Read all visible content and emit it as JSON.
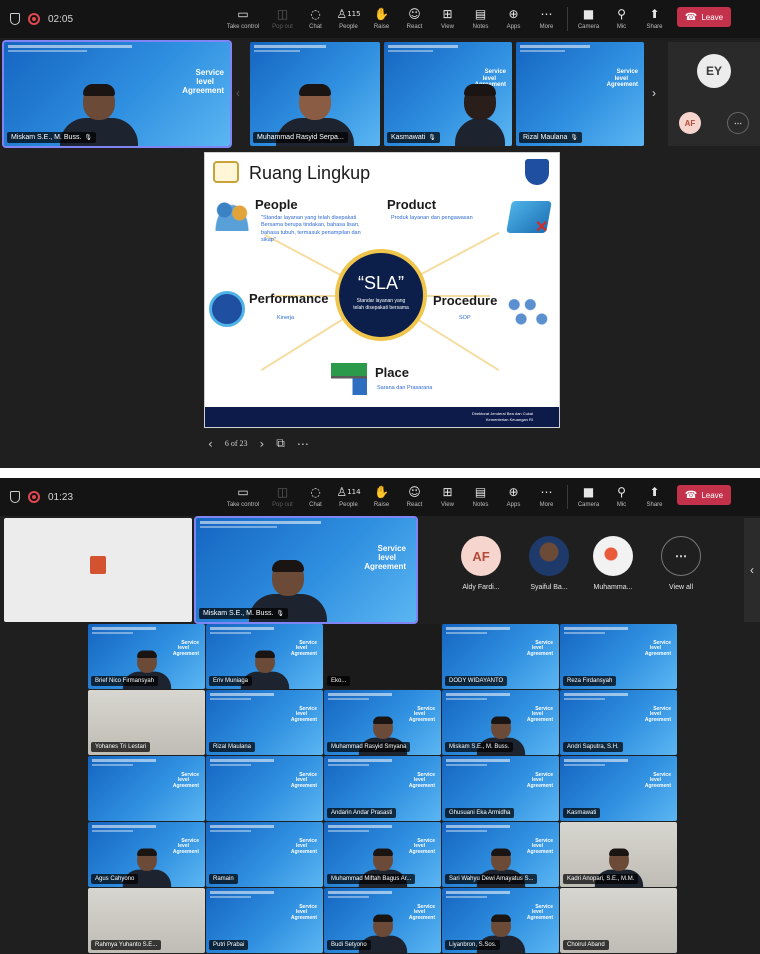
{
  "toolbar_top": {
    "timer": "02:05",
    "people_count": "115",
    "buttons": [
      {
        "label": "Take control",
        "icon": "take-control-icon"
      },
      {
        "label": "Pop out",
        "icon": "pop-out-icon"
      },
      {
        "label": "Chat",
        "icon": "chat-icon"
      },
      {
        "label": "People",
        "icon": "people-icon"
      },
      {
        "label": "Raise",
        "icon": "raise-hand-icon"
      },
      {
        "label": "React",
        "icon": "react-icon"
      },
      {
        "label": "View",
        "icon": "view-icon"
      },
      {
        "label": "Notes",
        "icon": "notes-icon"
      },
      {
        "label": "Apps",
        "icon": "apps-icon"
      },
      {
        "label": "More",
        "icon": "more-icon"
      },
      {
        "label": "Camera",
        "icon": "camera-off-icon"
      },
      {
        "label": "Mic",
        "icon": "mic-off-icon"
      },
      {
        "label": "Share",
        "icon": "share-icon"
      }
    ],
    "leave": "Leave"
  },
  "toolbar_bottom": {
    "timer": "01:23",
    "people_count": "114",
    "leave": "Leave"
  },
  "top_tiles": [
    {
      "name": "Miskam S.E., M. Buss.",
      "sla": [
        "Service",
        "level",
        "Agreement"
      ]
    },
    {
      "name": "Muhammad Rasyid Serpa..."
    },
    {
      "name": "Kasmawati"
    },
    {
      "name": "Rizal Maulana"
    }
  ],
  "top_avatars": {
    "ey": "EY",
    "af": "AF"
  },
  "slide": {
    "title": "Ruang Lingkup",
    "people": {
      "head": "People",
      "sub": "\"Standar layanan yang telah disepakati Bersama berupa tindakan, bahasa lisan, bahasa tubuh, termasuk penampilan dan sikap\""
    },
    "product": {
      "head": "Product",
      "sub": "Produk layanan dan pengawasan"
    },
    "performance": {
      "head": "Performance",
      "sub": "Kinerja"
    },
    "procedure": {
      "head": "Procedure",
      "sub": "SOP"
    },
    "place": {
      "head": "Place",
      "sub": "Sarana dan Prasarana"
    },
    "center": {
      "big": "“SLA”",
      "small": "Standar layanan yang telah disepakati bersama"
    },
    "footer": "Direktorat Jenderal Bea dan Cukai Kementerian Keuangan RI",
    "page": "6 of 23"
  },
  "bottom_featured": {
    "name": "Miskam S.E., M. Buss.",
    "sla": [
      "Service",
      "level",
      "Agreement"
    ]
  },
  "bottom_avatars": [
    {
      "initials": "AF",
      "label": "Aldy Fardi..."
    },
    {
      "initials": "",
      "label": "Syaiful Ba..."
    },
    {
      "initials": "",
      "label": "Muhamma..."
    },
    {
      "initials": "⋯",
      "label": "View all"
    }
  ],
  "grid": [
    {
      "name": "Brief Nico Firmansyah"
    },
    {
      "name": "Eriv Muniaga"
    },
    {
      "name": "Eko..."
    },
    {
      "name": "DODY WIDAYANTO"
    },
    {
      "name": "Reza Firdansyah"
    },
    {
      "name": "Yohanes Tri Lestari"
    },
    {
      "name": "Rizal Maulana"
    },
    {
      "name": "Muhammad Rasyid Smyana"
    },
    {
      "name": "Miskam S.E., M. Buss."
    },
    {
      "name": "Andri Saputra, S.H."
    },
    {
      "name": ""
    },
    {
      "name": ""
    },
    {
      "name": "Andarin Andar Prasasti"
    },
    {
      "name": "Ghusuani Eka Armidha"
    },
    {
      "name": "Kasmawati"
    },
    {
      "name": "Agus Cahyono"
    },
    {
      "name": "Ramain"
    },
    {
      "name": "Muhammad Miftah Bagus Ar..."
    },
    {
      "name": "Sari Wahyu Dewi Amayatus S..."
    },
    {
      "name": "Kadri Anopari, S.E., M.M."
    },
    {
      "name": "Rahmya Yuhanto S.E..."
    },
    {
      "name": "Putri Prabai"
    },
    {
      "name": "Budi Setyono"
    },
    {
      "name": "Liyanbron, S.Sos."
    },
    {
      "name": "Choirul Aband"
    }
  ]
}
